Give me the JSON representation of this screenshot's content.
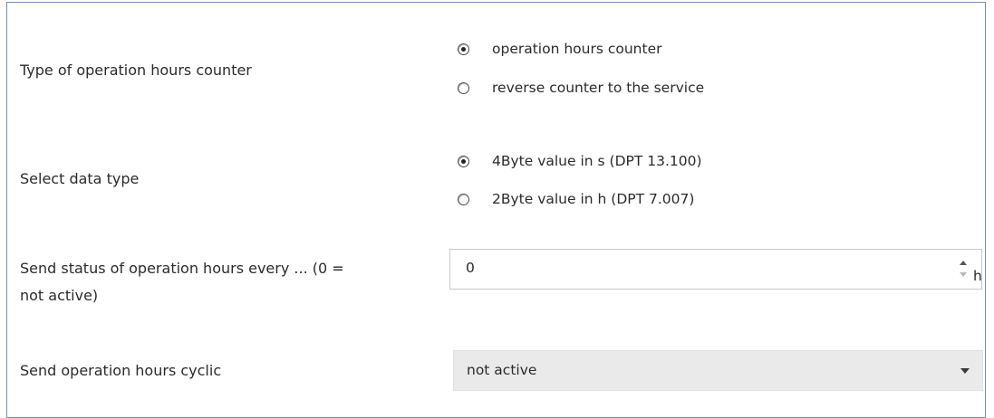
{
  "params": {
    "counter_type": {
      "label": "Type of operation hours counter",
      "options": [
        {
          "label": "operation hours counter",
          "checked": true
        },
        {
          "label": "reverse counter to the service",
          "checked": false
        }
      ]
    },
    "data_type": {
      "label": "Select data type",
      "options": [
        {
          "label": "4Byte value in s (DPT 13.100)",
          "checked": true
        },
        {
          "label": "2Byte value in h (DPT 7.007)",
          "checked": false
        }
      ]
    },
    "send_status": {
      "label_line1": "Send status of operation hours every ... (0 =",
      "label_line2": "not active)",
      "value": "0",
      "unit": "h"
    },
    "send_cyclic": {
      "label": "Send operation hours cyclic",
      "value": "not active"
    }
  },
  "icons": {
    "spin_up": "spin-up-icon",
    "spin_down": "spin-down-icon",
    "dropdown": "chevron-down-icon"
  }
}
